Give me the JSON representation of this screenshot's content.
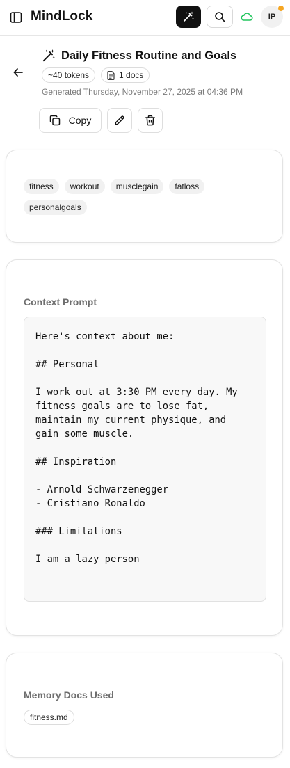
{
  "app": {
    "title": "MindLock",
    "avatar_initials": "IP",
    "status_dot_color": "#f5a623",
    "cloud_color": "#22c55e"
  },
  "icons": {
    "sidebar": "sidebar-panel-icon",
    "generate": "magic-wand-icon",
    "search": "search-icon",
    "cloud": "cloud-icon",
    "back": "arrow-left-icon",
    "title": "magic-wand-icon",
    "doc": "document-icon",
    "copy": "copy-icon",
    "edit": "pencil-icon",
    "delete": "trash-icon"
  },
  "document": {
    "title": "Daily Fitness Routine and Goals",
    "tokens": "~40 tokens",
    "docs": "1 docs",
    "generated_at": "Generated Thursday, November 27, 2025 at 04:36 PM"
  },
  "actions": {
    "copy_label": "Copy"
  },
  "tags": [
    "fitness",
    "workout",
    "musclegain",
    "fatloss",
    "personalgoals"
  ],
  "context": {
    "label": "Context Prompt",
    "body": "Here's context about me:\n\n## Personal\n\nI work out at 3:30 PM every day. My fitness goals are to lose fat, maintain my current physique, and gain some muscle.\n\n## Inspiration\n\n- Arnold Schwarzenegger\n- Cristiano Ronaldo\n\n### Limitations\n\nI am a lazy person"
  },
  "memory": {
    "label": "Memory Docs Used",
    "docs": [
      "fitness.md"
    ]
  }
}
